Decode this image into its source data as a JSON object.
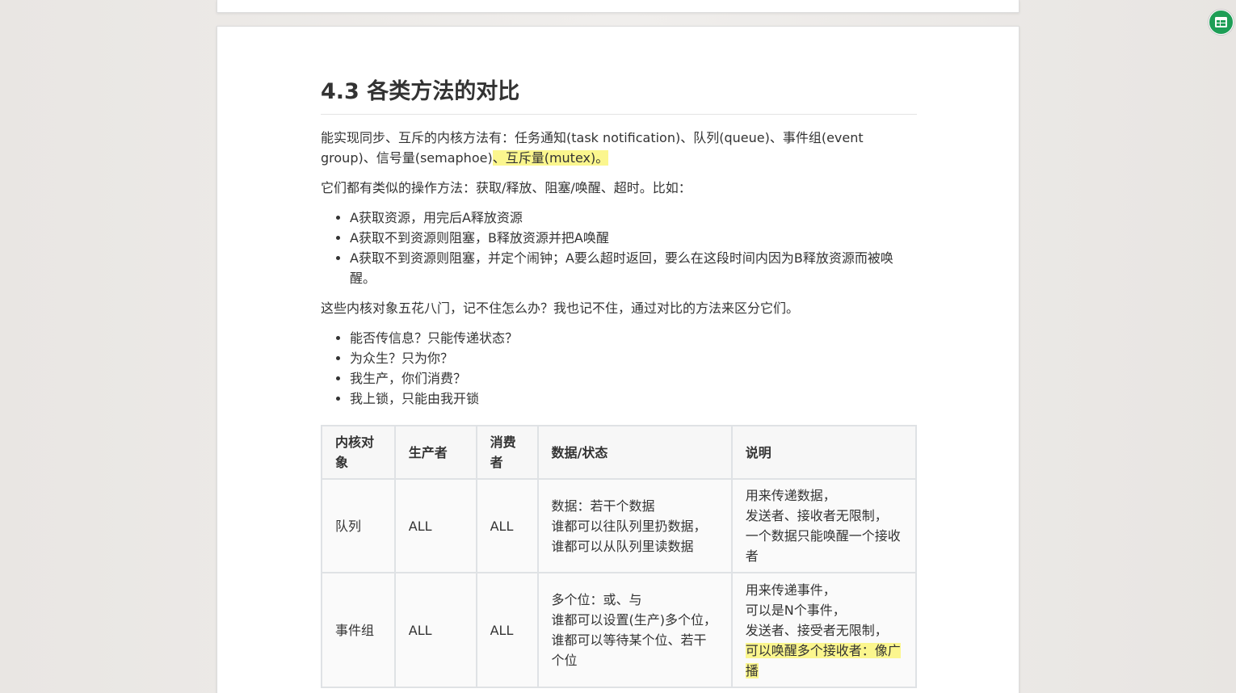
{
  "heading": "4.3 各类方法的对比",
  "para1": {
    "text": "能实现同步、互斥的内核方法有：任务通知(task notification)、队列(queue)、事件组(event group)、信号量(semaphoe)",
    "highlight": "、互斥量(mutex)。"
  },
  "para2": "它们都有类似的操作方法：获取/释放、阻塞/唤醒、超时。比如：",
  "list1": [
    "A获取资源，用完后A释放资源",
    "A获取不到资源则阻塞，B释放资源并把A唤醒",
    "A获取不到资源则阻塞，并定个闹钟；A要么超时返回，要么在这段时间内因为B释放资源而被唤醒。"
  ],
  "para3": "这些内核对象五花八门，记不住怎么办？我也记不住，通过对比的方法来区分它们。",
  "list2": [
    "能否传信息？只能传递状态？",
    "为众生？只为你？",
    "我生产，你们消费？",
    "我上锁，只能由我开锁"
  ],
  "table": {
    "headers": [
      "内核对象",
      "生产者",
      "消费者",
      "数据/状态",
      "说明"
    ],
    "rows": [
      {
        "object": "队列",
        "producer": "ALL",
        "consumer": "ALL",
        "data": [
          "数据：若干个数据",
          "谁都可以往队列里扔数据，",
          "谁都可以从队列里读数据"
        ],
        "note": [
          "用来传递数据，",
          "发送者、接收者无限制，",
          "一个数据只能唤醒一个接收者"
        ],
        "note_highlight": ""
      },
      {
        "object": "事件组",
        "producer": "ALL",
        "consumer": "ALL",
        "data": [
          "多个位：或、与",
          "谁都可以设置(生产)多个位，",
          "谁都可以等待某个位、若干个位"
        ],
        "note": [
          "用来传递事件，",
          "可以是N个事件，",
          "发送者、接受者无限制，"
        ],
        "note_highlight": "可以唤醒多个接收者：像广播"
      }
    ]
  },
  "accent_color": "#1e9e56",
  "highlight_color": "#fbf68e",
  "fab_icon": "spreadsheet-icon"
}
